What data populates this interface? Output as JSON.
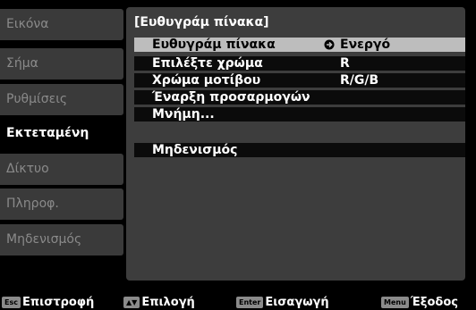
{
  "sidebar": {
    "items": [
      {
        "label": "Εικόνα"
      },
      {
        "label": "Σήμα"
      },
      {
        "label": "Ρυθμίσεις"
      },
      {
        "label": "Εκτεταμένη"
      },
      {
        "label": "Δίκτυο"
      },
      {
        "label": "Πληροφ."
      },
      {
        "label": "Μηδενισμός"
      }
    ]
  },
  "panel": {
    "title": "[Ευθυγράμ πίνακα]",
    "rows": [
      {
        "label": "Ευθυγράμ πίνακα",
        "value": "Ενεργό"
      },
      {
        "label": "Επιλέξτε χρώμα",
        "value": "R"
      },
      {
        "label": "Χρώμα μοτίβου",
        "value": "R/G/B"
      },
      {
        "label": "Έναρξη προσαρμογών",
        "value": ""
      },
      {
        "label": "Μνήμη...",
        "value": ""
      },
      {
        "label": "Μηδενισμός",
        "value": ""
      }
    ]
  },
  "footer": {
    "back_key": "Esc",
    "back_label": "Επιστροφή",
    "select_key": "▲▼",
    "select_label": "Επιλογή",
    "enter_key": "Enter",
    "enter_label": "Εισαγωγή",
    "menu_key": "Menu",
    "menu_label": "Έξοδος"
  },
  "colors": {
    "selected_row": "#bdbdbd",
    "panel_bg": "#3d3d3d",
    "sidebar_bg": "#3a3a3a"
  }
}
